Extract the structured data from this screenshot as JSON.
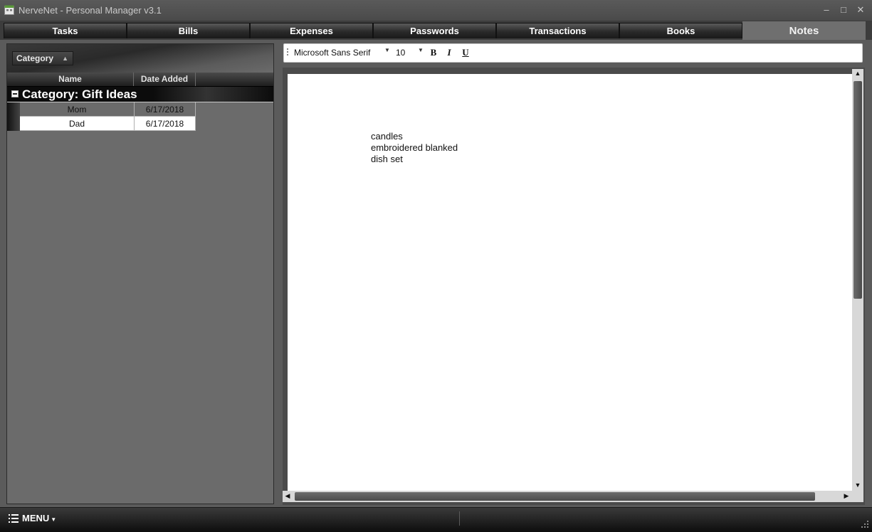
{
  "window": {
    "title": "NerveNet - Personal Manager v3.1",
    "minimize_label": "–",
    "maximize_label": "□",
    "close_label": "✕"
  },
  "tabs": [
    {
      "label": "Tasks"
    },
    {
      "label": "Bills"
    },
    {
      "label": "Expenses"
    },
    {
      "label": "Passwords"
    },
    {
      "label": "Transactions"
    },
    {
      "label": "Books"
    },
    {
      "label": "Notes"
    }
  ],
  "active_tab": "Notes",
  "notes_grid": {
    "group_by_label": "Category",
    "columns": [
      "Name",
      "Date Added"
    ],
    "group_title": "Category: Gift Ideas",
    "rows": [
      {
        "name": "Mom",
        "date": "6/17/2018"
      },
      {
        "name": "Dad",
        "date": "6/17/2018"
      }
    ]
  },
  "toolbar": {
    "font_name": "Microsoft Sans Serif",
    "font_size": "10",
    "bold_label": "B",
    "italic_label": "I",
    "underline_label": "U"
  },
  "editor": {
    "lines": [
      "candles",
      "embroidered blanked",
      "dish set"
    ]
  },
  "statusbar": {
    "menu_label": "MENU"
  },
  "colors": {
    "background": "#5b5b5b",
    "tab_active": "#6f6f6f",
    "tab_inactive": "#1e1e1e",
    "editor_bg": "#ffffff",
    "selected_row": "#6b6b6b"
  },
  "icons": {
    "app": "app-icon",
    "menu": "list-icon",
    "expand": "minus-box-icon",
    "sort": "triangle-up-icon",
    "grip": "toolbar-grip-icon",
    "resize": "size-grip-icon"
  }
}
